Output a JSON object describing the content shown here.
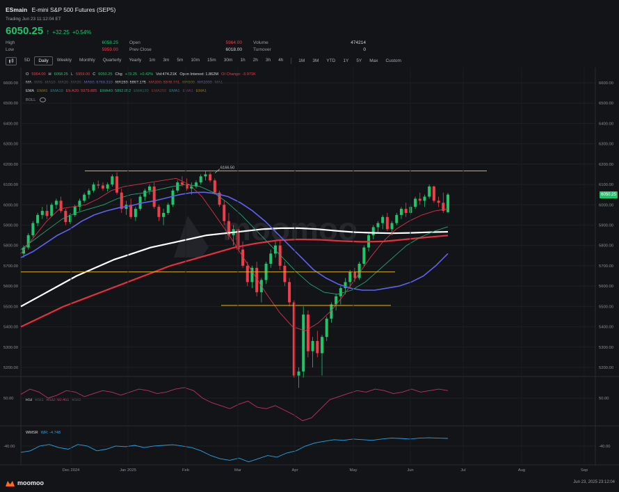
{
  "header": {
    "symbol": "ESmain",
    "name": "E-mini S&P 500 Futures (SEP5)",
    "trading": "Trading Jun 23 11:12:04 ET",
    "last": "6050.25",
    "change": "+32.25",
    "change_pct": "+0.54%",
    "stats": {
      "high_label": "High",
      "high": "6058.25",
      "low_label": "Low",
      "low": "5959.00",
      "open_label": "Open",
      "open": "5964.00",
      "prevclose_label": "Prev Close",
      "prevclose": "6018.00",
      "volume_label": "Volume",
      "volume": "474214",
      "turnover_label": "Turnover",
      "turnover": "0"
    }
  },
  "toolbar": {
    "chart_type_icon": "candlestick-icon",
    "ranges": [
      "5D",
      "Daily",
      "Weekly",
      "Monthly",
      "Quarterly",
      "Yearly",
      "1m",
      "3m",
      "5m",
      "10m",
      "15m",
      "30m",
      "1h",
      "2h",
      "3h",
      "4h"
    ],
    "active": "Daily",
    "periods": [
      "1M",
      "3M",
      "YTD",
      "1Y",
      "5Y",
      "Max",
      "Custom"
    ]
  },
  "legend": {
    "ohlc": [
      {
        "t": "O",
        "c": "#d6d7db"
      },
      {
        "t": "5964.00",
        "c": "#ee3e4a"
      },
      {
        "t": "H",
        "c": "#d6d7db"
      },
      {
        "t": "6058.25",
        "c": "#20c46a"
      },
      {
        "t": "L",
        "c": "#d6d7db"
      },
      {
        "t": "5959.00",
        "c": "#ee3e4a"
      },
      {
        "t": "C",
        "c": "#d6d7db"
      },
      {
        "t": "6050.25",
        "c": "#20c46a"
      },
      {
        "t": "Chg",
        "c": "#d6d7db"
      },
      {
        "t": "+23.25",
        "c": "#20c46a"
      },
      {
        "t": "+0.42%",
        "c": "#20c46a"
      },
      {
        "t": "Vol:474.21K",
        "c": "#d6d7db"
      },
      {
        "t": "Open Interest: 1.862M",
        "c": "#d6d7db"
      },
      {
        "t": "OI Change: -3.971K",
        "c": "#ee3e4a"
      }
    ],
    "ma": [
      {
        "t": "MA",
        "c": "#d6d7db"
      },
      {
        "t": "MA5",
        "c": "#5b5d63"
      },
      {
        "t": "MA10",
        "c": "#5b5d63"
      },
      {
        "t": "MA20",
        "c": "#5b5d63"
      },
      {
        "t": "MA30",
        "c": "#5b5d63"
      },
      {
        "t": "MA50: 5769.310",
        "c": "#6b6cf0"
      },
      {
        "t": "MA150: 5867.175",
        "c": "#e6e6e6"
      },
      {
        "t": "MA200: 5848.741",
        "c": "#ee3e4a"
      },
      {
        "t": "MA500",
        "c": "#8a7420"
      },
      {
        "t": "MA1000",
        "c": "#6b6cb0"
      },
      {
        "t": "MA1",
        "c": "#5b5d63"
      }
    ],
    "ema": [
      {
        "t": "EMA",
        "c": "#d6d7db"
      },
      {
        "t": "EMA5",
        "c": "#8a7420"
      },
      {
        "t": "EMA10",
        "c": "#3a7b8a"
      },
      {
        "t": "EMA20: 5979.885",
        "c": "#ee3e4a"
      },
      {
        "t": "EMA40: 5892.052",
        "c": "#26b07a"
      },
      {
        "t": "EMA120",
        "c": "#2f6b57"
      },
      {
        "t": "EMA250",
        "c": "#7a3a3a"
      },
      {
        "t": "EMA1",
        "c": "#3a7b8a"
      },
      {
        "t": "EMA1",
        "c": "#6b3a6b"
      },
      {
        "t": "EMA1",
        "c": "#8a7420"
      }
    ],
    "boll": "BOLL",
    "rsi": [
      {
        "t": "RSI",
        "c": "#d6d7db"
      },
      {
        "t": "RSI1",
        "c": "#5b5d63"
      },
      {
        "t": "RSI2: 60.451",
        "c": "#d63a6a"
      },
      {
        "t": "RSI3",
        "c": "#5b5d63"
      }
    ],
    "wmsr": [
      {
        "t": "WMSR",
        "c": "#d6d7db"
      },
      {
        "t": "WR: -4.748",
        "c": "#2aa3e8"
      }
    ]
  },
  "axis": {
    "price_ticks": [
      "6600.00",
      "6500.00",
      "6400.00",
      "6300.00",
      "6200.00",
      "6100.00",
      "6000.00",
      "5900.00",
      "5800.00",
      "5700.00",
      "5600.00",
      "5500.00",
      "5400.00",
      "5300.00",
      "5200.00"
    ],
    "months": [
      "Dec 2024",
      "Jan 2025",
      "Feb",
      "Mar",
      "Apr",
      "May",
      "Jun",
      "Jul",
      "Aug",
      "Sep"
    ],
    "rsi_tick": "50.00",
    "wmsr_tick": "-40.00",
    "last_tag": "6050.25",
    "peak_label": "6166.50"
  },
  "colors": {
    "up": "#20c46a",
    "down": "#ee3e4a",
    "ma50": "#5f63f2",
    "ma150": "#ffffff",
    "ma200": "#e4303f",
    "ema20": "#d43646",
    "ema40": "#25a86e",
    "level": "#e6b422",
    "rsi": "#c43060",
    "wr": "#2aa3e8"
  },
  "footer": {
    "logo_text": "moomoo",
    "watermark": "moomoo",
    "timestamp": "Jun 23, 2025 23:12:04"
  },
  "chart_data": {
    "type": "candlestick",
    "title": "E-mini S&P 500 Futures (SEP5) Daily",
    "ylabel": "",
    "xlabel": "",
    "ylim": [
      5150,
      6650
    ],
    "grid": true,
    "candles": [
      [
        5760,
        5800,
        5740,
        5790
      ],
      [
        5790,
        5860,
        5780,
        5850
      ],
      [
        5850,
        5920,
        5840,
        5910
      ],
      [
        5910,
        5960,
        5895,
        5950
      ],
      [
        5950,
        5990,
        5930,
        5970
      ],
      [
        5970,
        6000,
        5930,
        5945
      ],
      [
        5945,
        6010,
        5940,
        6000
      ],
      [
        6000,
        6030,
        5980,
        6020
      ],
      [
        6020,
        6040,
        5960,
        5970
      ],
      [
        5970,
        5980,
        5900,
        5915
      ],
      [
        5915,
        5960,
        5905,
        5950
      ],
      [
        5950,
        6000,
        5940,
        5990
      ],
      [
        5990,
        6030,
        5970,
        6020
      ],
      [
        6020,
        6060,
        6010,
        6050
      ],
      [
        6050,
        6080,
        6030,
        6070
      ],
      [
        6070,
        6110,
        6060,
        6100
      ],
      [
        6100,
        6120,
        6080,
        6095
      ],
      [
        6095,
        6110,
        6070,
        6080
      ],
      [
        6080,
        6110,
        6065,
        6100
      ],
      [
        6100,
        6150,
        6090,
        6140
      ],
      [
        6140,
        6160,
        6050,
        6060
      ],
      [
        6060,
        6080,
        5960,
        5980
      ],
      [
        5980,
        6020,
        5950,
        6000
      ],
      [
        6000,
        6030,
        5930,
        5940
      ],
      [
        5940,
        5990,
        5920,
        5980
      ],
      [
        5980,
        6050,
        5970,
        6040
      ],
      [
        6040,
        6080,
        6020,
        6070
      ],
      [
        6070,
        6100,
        6050,
        6090
      ],
      [
        6090,
        6110,
        5980,
        5990
      ],
      [
        5990,
        6000,
        5920,
        5940
      ],
      [
        5940,
        5980,
        5900,
        5960
      ],
      [
        5960,
        6010,
        5950,
        6000
      ],
      [
        6000,
        6080,
        5990,
        6070
      ],
      [
        6070,
        6120,
        6060,
        6110
      ],
      [
        6110,
        6140,
        6090,
        6100
      ],
      [
        6100,
        6130,
        6070,
        6080
      ],
      [
        6080,
        6110,
        6050,
        6090
      ],
      [
        6090,
        6120,
        6080,
        6110
      ],
      [
        6110,
        6150,
        6100,
        6140
      ],
      [
        6140,
        6166,
        6120,
        6150
      ],
      [
        6150,
        6160,
        6110,
        6120
      ],
      [
        6120,
        6130,
        6050,
        6060
      ],
      [
        6060,
        6070,
        5990,
        6000
      ],
      [
        6000,
        6020,
        5900,
        5920
      ],
      [
        5920,
        5960,
        5830,
        5850
      ],
      [
        5850,
        5900,
        5800,
        5880
      ],
      [
        5880,
        5890,
        5760,
        5780
      ],
      [
        5780,
        5820,
        5690,
        5700
      ],
      [
        5700,
        5720,
        5600,
        5620
      ],
      [
        5620,
        5700,
        5590,
        5690
      ],
      [
        5690,
        5720,
        5550,
        5570
      ],
      [
        5570,
        5640,
        5520,
        5630
      ],
      [
        5630,
        5720,
        5610,
        5710
      ],
      [
        5710,
        5780,
        5690,
        5760
      ],
      [
        5760,
        5820,
        5740,
        5800
      ],
      [
        5800,
        5830,
        5680,
        5700
      ],
      [
        5700,
        5720,
        5600,
        5620
      ],
      [
        5620,
        5640,
        5500,
        5520
      ],
      [
        5520,
        5530,
        5150,
        5160
      ],
      [
        5160,
        5200,
        5100,
        5180
      ],
      [
        5180,
        5500,
        5150,
        5460
      ],
      [
        5460,
        5480,
        5250,
        5280
      ],
      [
        5280,
        5350,
        5200,
        5330
      ],
      [
        5330,
        5380,
        5250,
        5270
      ],
      [
        5270,
        5360,
        5160,
        5350
      ],
      [
        5350,
        5450,
        5330,
        5440
      ],
      [
        5440,
        5520,
        5420,
        5510
      ],
      [
        5510,
        5560,
        5480,
        5550
      ],
      [
        5550,
        5600,
        5510,
        5590
      ],
      [
        5590,
        5640,
        5560,
        5620
      ],
      [
        5620,
        5680,
        5590,
        5670
      ],
      [
        5670,
        5690,
        5620,
        5640
      ],
      [
        5640,
        5720,
        5630,
        5710
      ],
      [
        5710,
        5800,
        5700,
        5790
      ],
      [
        5790,
        5860,
        5770,
        5850
      ],
      [
        5850,
        5900,
        5830,
        5890
      ],
      [
        5890,
        5920,
        5860,
        5910
      ],
      [
        5910,
        5950,
        5880,
        5940
      ],
      [
        5940,
        5960,
        5870,
        5880
      ],
      [
        5880,
        5920,
        5850,
        5910
      ],
      [
        5910,
        5960,
        5900,
        5950
      ],
      [
        5950,
        5990,
        5930,
        5980
      ],
      [
        5980,
        6010,
        5940,
        5960
      ],
      [
        5960,
        6000,
        5950,
        5990
      ],
      [
        5990,
        6040,
        5980,
        6030
      ],
      [
        6030,
        6060,
        6000,
        6020
      ],
      [
        6020,
        6050,
        5990,
        6040
      ],
      [
        6040,
        6100,
        6030,
        6090
      ],
      [
        6090,
        6095,
        6010,
        6020
      ],
      [
        6020,
        6040,
        5990,
        6010
      ],
      [
        6010,
        6060,
        5960,
        5970
      ],
      [
        5964,
        6058.25,
        5959,
        6050.25
      ]
    ],
    "levels": [
      6166.5,
      5670,
      5505
    ],
    "lines": {
      "MA50": [
        5740,
        5770,
        5810,
        5850,
        5880,
        5920,
        5950,
        5970,
        5985,
        5995,
        6010,
        6020,
        6035,
        6050,
        6060,
        6062,
        6055,
        6040,
        6010,
        5970,
        5920,
        5860,
        5800,
        5740,
        5680,
        5640,
        5610,
        5590,
        5580,
        5580,
        5590,
        5600,
        5620,
        5650,
        5700,
        5760
      ],
      "MA150": [
        5500,
        5550,
        5600,
        5650,
        5690,
        5730,
        5760,
        5790,
        5810,
        5830,
        5850,
        5860,
        5870,
        5880,
        5885,
        5885,
        5880,
        5872,
        5865,
        5862,
        5860,
        5862,
        5865,
        5867
      ],
      "MA200": [
        5400,
        5450,
        5500,
        5540,
        5580,
        5620,
        5660,
        5700,
        5730,
        5760,
        5790,
        5810,
        5825,
        5830,
        5828,
        5822,
        5818,
        5820,
        5830,
        5840,
        5849
      ],
      "EMA20": [
        5760,
        5840,
        5920,
        5980,
        5990,
        6000,
        6030,
        6070,
        6090,
        6100,
        6110,
        6120,
        6130,
        6100,
        6040,
        5950,
        5860,
        5760,
        5660,
        5560,
        5470,
        5400,
        5380,
        5420,
        5480,
        5560,
        5650,
        5740,
        5820,
        5880,
        5920,
        5950,
        5970,
        5980
      ],
      "EMA40": [
        5780,
        5830,
        5880,
        5930,
        5960,
        5980,
        6000,
        6030,
        6050,
        6060,
        6075,
        6090,
        6100,
        6090,
        6060,
        6010,
        5950,
        5880,
        5810,
        5740,
        5670,
        5610,
        5570,
        5560,
        5580,
        5620,
        5680,
        5740,
        5800,
        5840,
        5870,
        5892
      ]
    },
    "rsi2": [
      55,
      62,
      58,
      50,
      54,
      60,
      58,
      52,
      56,
      60,
      58,
      54,
      58,
      62,
      60,
      56,
      58,
      62,
      64,
      60,
      50,
      44,
      40,
      36,
      42,
      46,
      38,
      36,
      40,
      34,
      28,
      20,
      24,
      36,
      48,
      52,
      56,
      60,
      58,
      62,
      60,
      56,
      58,
      62,
      58,
      60,
      62,
      60
    ],
    "wr": [
      -60,
      -55,
      -40,
      -35,
      -45,
      -50,
      -35,
      -40,
      -55,
      -50,
      -40,
      -42,
      -38,
      -45,
      -40,
      -38,
      -36,
      -40,
      -45,
      -55,
      -70,
      -80,
      -85,
      -78,
      -90,
      -80,
      -70,
      -75,
      -62,
      -55,
      -40,
      -30,
      -25,
      -20,
      -22,
      -18,
      -20,
      -22,
      -18,
      -15,
      -16,
      -18,
      -15,
      -14,
      -15,
      -16
    ]
  }
}
